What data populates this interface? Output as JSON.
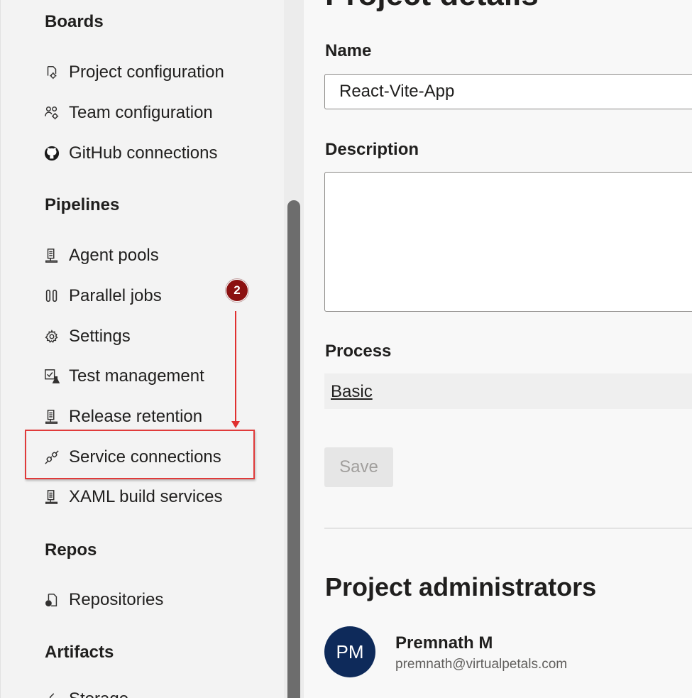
{
  "sidebar": {
    "sections": [
      {
        "heading": "Boards",
        "items": [
          {
            "label": "Project configuration",
            "icon": "project-config-icon"
          },
          {
            "label": "Team configuration",
            "icon": "team-config-icon"
          },
          {
            "label": "GitHub connections",
            "icon": "github-icon"
          }
        ]
      },
      {
        "heading": "Pipelines",
        "items": [
          {
            "label": "Agent pools",
            "icon": "agent-pools-icon"
          },
          {
            "label": "Parallel jobs",
            "icon": "parallel-jobs-icon"
          },
          {
            "label": "Settings",
            "icon": "gear-icon"
          },
          {
            "label": "Test management",
            "icon": "test-management-icon"
          },
          {
            "label": "Release retention",
            "icon": "release-retention-icon"
          },
          {
            "label": "Service connections",
            "icon": "service-connections-icon"
          },
          {
            "label": "XAML build services",
            "icon": "xaml-build-icon"
          }
        ]
      },
      {
        "heading": "Repos",
        "items": [
          {
            "label": "Repositories",
            "icon": "repositories-icon"
          }
        ]
      },
      {
        "heading": "Artifacts",
        "items": [
          {
            "label": "Storage",
            "icon": "storage-icon"
          }
        ]
      }
    ]
  },
  "annotation": {
    "step_number": "2",
    "color": "#e0302f"
  },
  "main": {
    "title": "Project details",
    "name_label": "Name",
    "name_value": "React-Vite-App",
    "description_label": "Description",
    "description_value": "",
    "process_label": "Process",
    "process_value": "Basic",
    "save_label": "Save",
    "admins_heading": "Project administrators",
    "admin": {
      "initials": "PM",
      "name": "Premnath M",
      "email": "premnath@virtualpetals.com",
      "avatar_color": "#0e2a5a"
    }
  }
}
